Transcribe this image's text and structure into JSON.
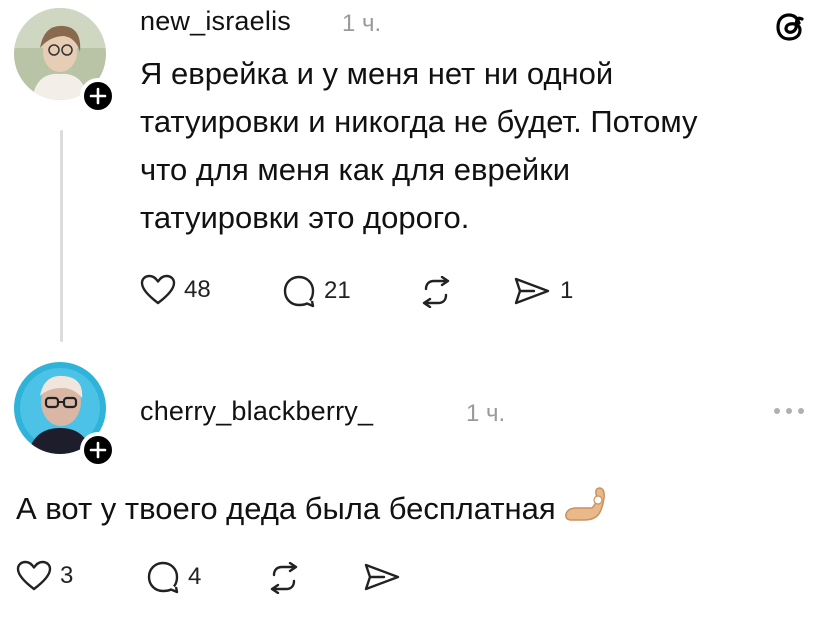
{
  "post1": {
    "username": "new_israelis",
    "time": "1 ч.",
    "lines": [
      "Я еврейка и у меня нет ни одной",
      "татуировки и никогда не будет. Потому",
      "что для меня как для еврейки",
      "татуировки это дорого."
    ],
    "likes": "48",
    "replies": "21",
    "shares": "1"
  },
  "post2": {
    "username": "cherry_blackberry_",
    "time": "1 ч.",
    "text": "А вот у твоего деда была бесплатная",
    "likes": "3",
    "replies": "4"
  },
  "icons": [
    "threads-logo-icon",
    "heart-icon",
    "comment-icon",
    "repost-icon",
    "send-icon",
    "plus-icon",
    "more-icon",
    "ok-hand-icon"
  ]
}
